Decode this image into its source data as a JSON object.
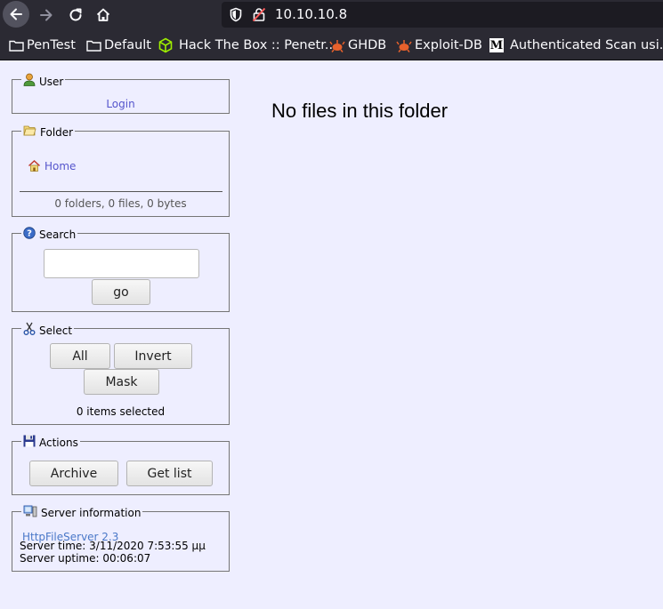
{
  "browser": {
    "url": "10.10.10.8",
    "bookmarks": [
      {
        "label": "PenTest",
        "icon": "folder-icon"
      },
      {
        "label": "Default",
        "icon": "folder-icon"
      },
      {
        "label": "Hack The Box :: Penetr...",
        "icon": "htb-cube-icon"
      },
      {
        "label": "GHDB",
        "icon": "exploitdb-icon"
      },
      {
        "label": "Exploit-DB",
        "icon": "exploitdb-icon"
      },
      {
        "label": "Authenticated Scan usi...",
        "icon": "medium-m-icon"
      }
    ]
  },
  "sidebar": {
    "user": {
      "title": "User",
      "login_link": "Login"
    },
    "folder": {
      "title": "Folder",
      "home_link": "Home",
      "stats": "0 folders, 0 files, 0 bytes"
    },
    "search": {
      "title": "Search",
      "value": "",
      "go_label": "go"
    },
    "select": {
      "title": "Select",
      "all_label": "All",
      "invert_label": "Invert",
      "mask_label": "Mask",
      "status": "0 items selected"
    },
    "actions": {
      "title": "Actions",
      "archive_label": "Archive",
      "getlist_label": "Get list"
    },
    "server": {
      "title": "Server information",
      "software_link": "HttpFileServer 2.3",
      "time": "Server time: 3/11/2020 7:53:55 μμ",
      "uptime": "Server uptime: 00:06:07"
    }
  },
  "main": {
    "message": "No files in this folder"
  },
  "colors": {
    "link": "#5555cc",
    "page_bg": "#eeeeff",
    "chrome_bg": "#2b2a33"
  }
}
